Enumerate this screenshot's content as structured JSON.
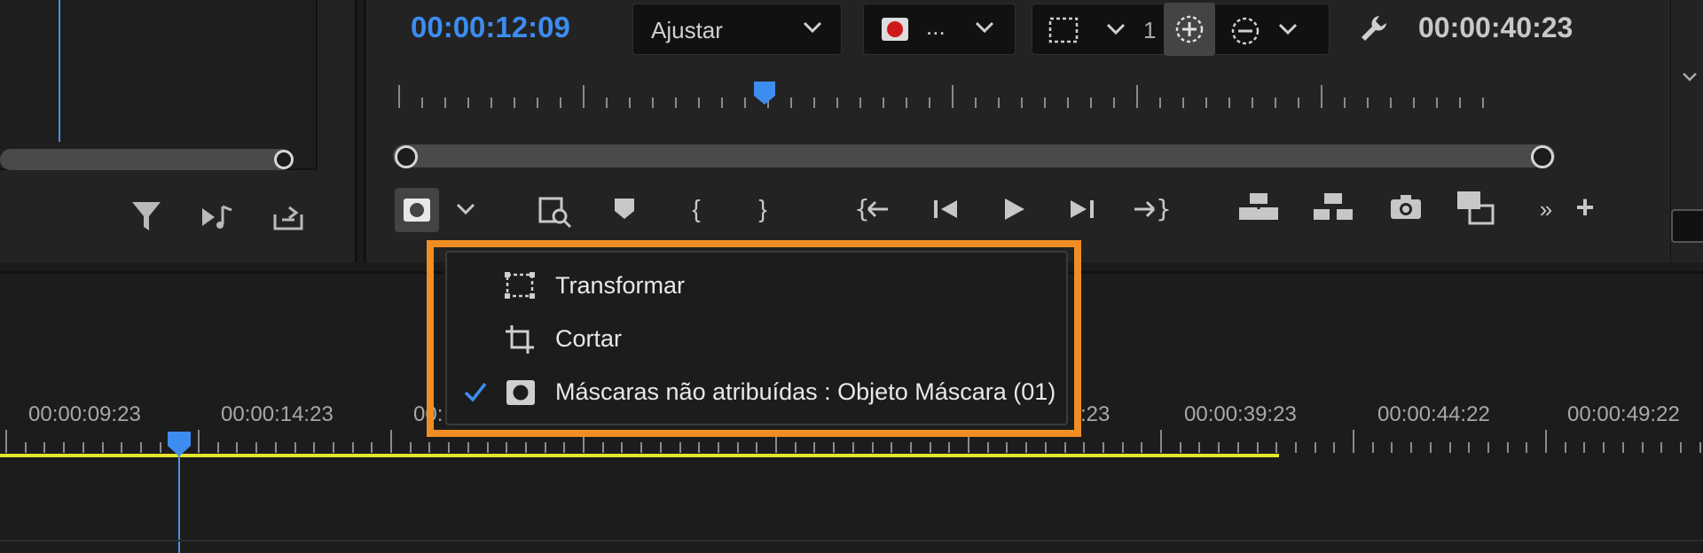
{
  "program": {
    "current_timecode": "00:00:12:09",
    "fit_dropdown": "Ajustar",
    "quality_dropdown": "...",
    "zoom_prefix": "1",
    "duration_timecode": "00:00:40:23"
  },
  "dropdown_menu": {
    "items": [
      {
        "label": "Transformar",
        "icon": "transform-icon",
        "checked": false
      },
      {
        "label": "Cortar",
        "icon": "crop-icon",
        "checked": false
      },
      {
        "label": "Máscaras não atribuídas : Objeto Máscara (01)",
        "icon": "mask-icon",
        "checked": true
      }
    ],
    "highlight_color": "#f08d24"
  },
  "timeline": {
    "ruler_labels": [
      "00:00:09:23",
      "00:00:14:23",
      "00:",
      ":23",
      "00:00:39:23",
      "00:00:44:22",
      "00:00:49:22"
    ]
  },
  "colors": {
    "accent": "#3d8cf0",
    "playhead": "#4a90e2",
    "work_area": "#e5e52a"
  }
}
